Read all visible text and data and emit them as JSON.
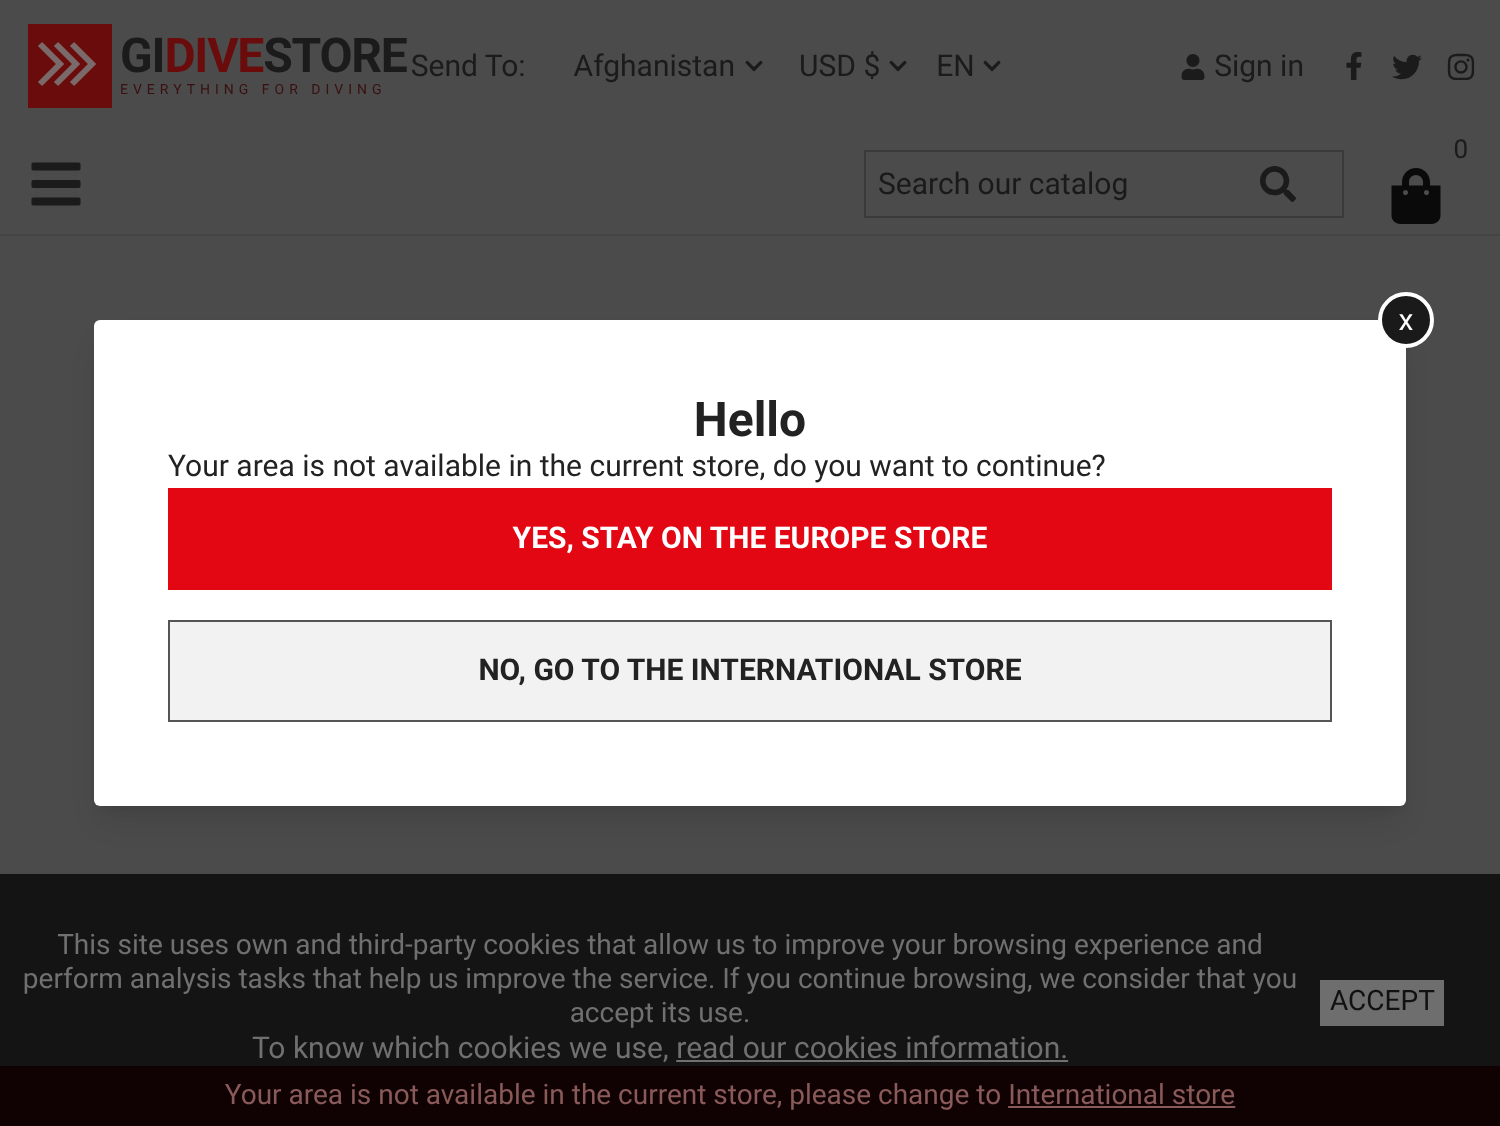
{
  "header": {
    "logo": {
      "part_1": "GI",
      "part_2": "DIVE",
      "part_3": "STORE",
      "tagline": "EVERYTHING FOR DIVING"
    },
    "send_to_label": "Send To:",
    "country": "Afghanistan",
    "currency": "USD $",
    "language": "EN",
    "sign_in": "Sign in",
    "search": {
      "placeholder": "Search our catalog"
    },
    "cart_count": "0"
  },
  "modal": {
    "close": "x",
    "title": "Hello",
    "message": "Your area is not available in the current store, do you want to continue?",
    "buttons": [
      {
        "kind": "primary",
        "label": "YES, STAY ON THE EUROPE STORE"
      },
      {
        "kind": "secondary",
        "label": "NO, GO TO THE INTERNATIONAL STORE"
      }
    ]
  },
  "cookie_banner": {
    "text": "This site uses own and third-party cookies that allow us to improve your browsing experience and perform analysis tasks that help us improve the service. If you continue browsing, we consider that you accept its use.",
    "link_prefix": "To know which cookies we use,",
    "link": "read our cookies information.",
    "accept": "ACCEPT"
  },
  "store_notice": {
    "text": "Your area is not available in the current store, please change to",
    "link": "International store"
  }
}
